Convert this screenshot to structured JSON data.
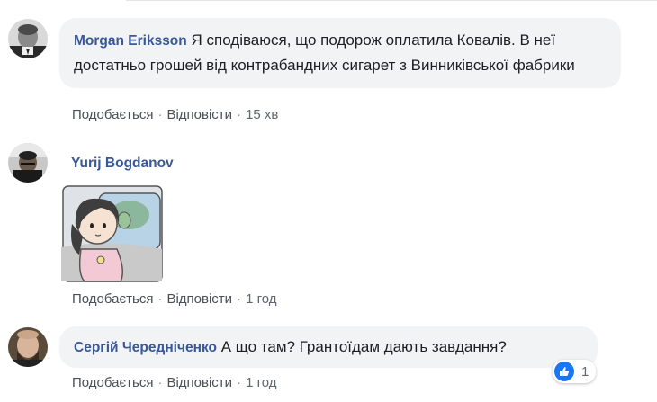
{
  "comments": [
    {
      "author": "Morgan Eriksson",
      "text": "Я сподіваюся, що подорож оплатила Ковалів. В неї достатньо грошей від контрабандних сигарет з Винниківської фабрики",
      "actions": {
        "like": "Подобається",
        "reply": "Відповісти",
        "separator": "·",
        "time": "15 хв"
      }
    },
    {
      "author": "Yurij Bogdanov",
      "sticker": "girl-on-train-sticker",
      "actions": {
        "like": "Подобається",
        "reply": "Відповісти",
        "separator": "·",
        "time": "1 год"
      }
    },
    {
      "author": "Сергій Чередніченко",
      "text": "А що там? Грантоїдам дають завдання?",
      "reaction": {
        "icon": "like-icon",
        "count": "1"
      },
      "actions": {
        "like": "Подобається",
        "reply": "Відповісти",
        "separator": "·",
        "time": "1 год"
      }
    }
  ],
  "colors": {
    "author": "#385898",
    "bubble": "#f2f3f5",
    "link": "#4b4f56",
    "like": "#1877f2"
  }
}
